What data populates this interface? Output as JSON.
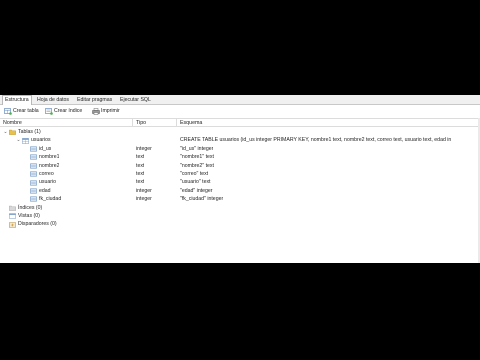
{
  "tabs": [
    {
      "label": "Estructura",
      "active": true
    },
    {
      "label": "Hoja de datos",
      "active": false
    },
    {
      "label": "Editar pragmas",
      "active": false
    },
    {
      "label": "Ejecutar SQL",
      "active": false
    }
  ],
  "toolbar": {
    "create_table": "Crear tabla",
    "create_index": "Crear índice",
    "print": "Imprimir"
  },
  "columns": {
    "name": "Nombre",
    "type": "Tipo",
    "schema": "Esquema"
  },
  "tree": {
    "tables": "Tablas (1)",
    "table": {
      "name": "usuarios",
      "schema": "CREATE TABLE usuarios (id_us integer PRIMARY KEY, nombre1 text, nombre2 text, correo text, usuario text, edad in"
    },
    "fields": [
      {
        "name": "id_us",
        "type": "integer",
        "schema": "\"id_us\" integer"
      },
      {
        "name": "nombre1",
        "type": "text",
        "schema": "\"nombre1\" text"
      },
      {
        "name": "nombre2",
        "type": "text",
        "schema": "\"nombre2\" text"
      },
      {
        "name": "correo",
        "type": "text",
        "schema": "\"correo\" text"
      },
      {
        "name": "usuario",
        "type": "text",
        "schema": "\"usuario\" text"
      },
      {
        "name": "edad",
        "type": "integer",
        "schema": "\"edad\" integer"
      },
      {
        "name": "fk_ciudad",
        "type": "integer",
        "schema": "\"fk_ciudad\" integer"
      }
    ],
    "indices": "Índices (0)",
    "views": "Vistas (0)",
    "triggers": "Disparadores (0)"
  },
  "colors": {
    "folder": "#e8c14a",
    "table_icon": "#7a9cc6",
    "field_icon": "#5b86b8"
  }
}
